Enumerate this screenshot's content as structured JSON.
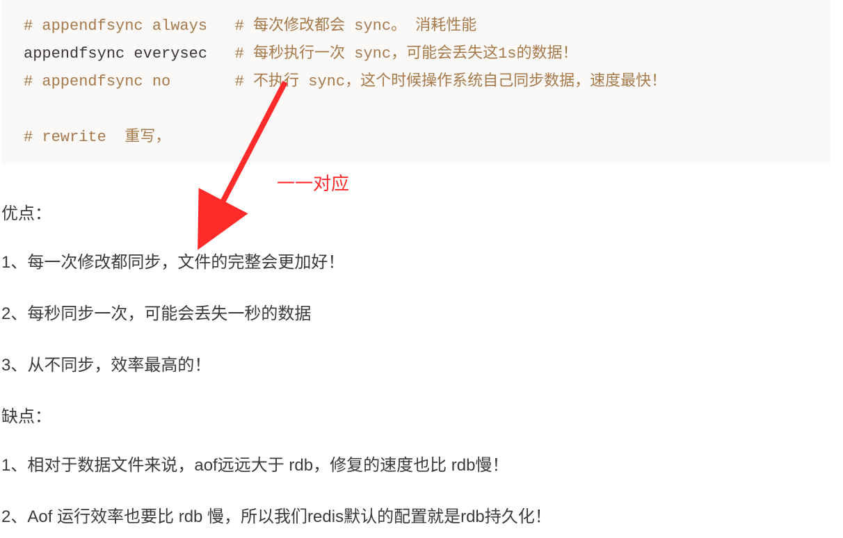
{
  "code": {
    "line1_a": "# appendfsync always",
    "line1_pad": "   ",
    "line1_b": "# 每次修改都会 sync。 消耗性能",
    "line2_a": "appendfsync everysec",
    "line2_pad": "   ",
    "line2_b": "# 每秒执行一次 sync，可能会丢失这1s的数据！",
    "line3_a": "# appendfsync no",
    "line3_pad": "       ",
    "line3_b": "# 不执行 sync，这个时候操作系统自己同步数据，速度最快！",
    "blank": " ",
    "line4_a": "# rewrite  ",
    "line4_b": "重写，"
  },
  "annotation": "一一对应",
  "advantages_title": "优点：",
  "advantages": [
    "1、每一次修改都同步，文件的完整会更加好！",
    "2、每秒同步一次，可能会丢失一秒的数据",
    "3、从不同步，效率最高的！"
  ],
  "disadvantages_title": "缺点：",
  "disadvantages": [
    "1、相对于数据文件来说，aof远远大于 rdb，修复的速度也比 rdb慢！",
    "2、Aof 运行效率也要比 rdb 慢，所以我们redis默认的配置就是rdb持久化！"
  ]
}
